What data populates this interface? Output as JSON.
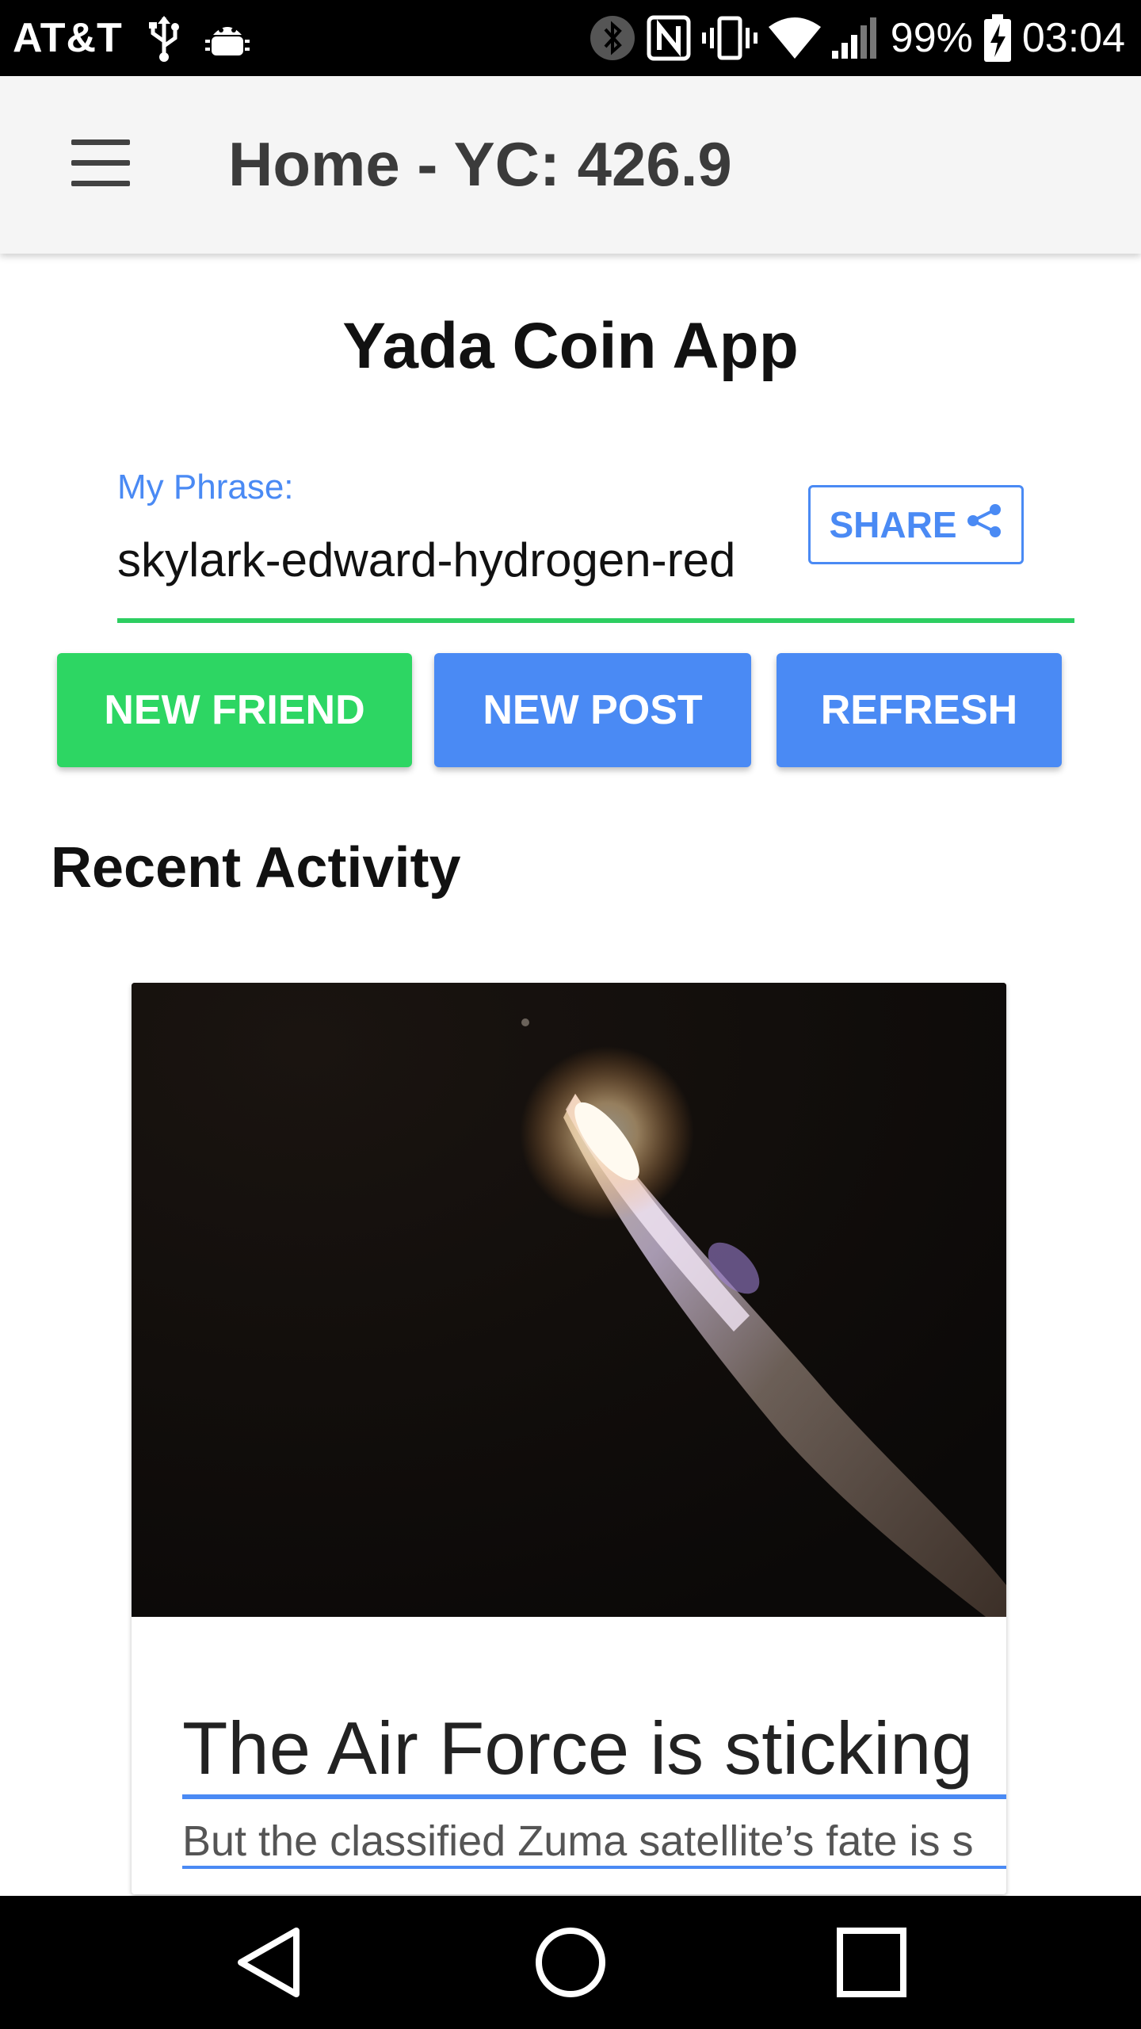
{
  "status_bar": {
    "carrier": "AT&T",
    "battery": "99%",
    "time": "03:04",
    "icons": [
      "usb-icon",
      "android-debug-icon",
      "bluetooth-icon",
      "nfc-icon",
      "vibrate-icon",
      "wifi-icon",
      "signal-icon",
      "battery-charging-icon"
    ]
  },
  "app_bar": {
    "title": "Home - YC: 426.9"
  },
  "main": {
    "app_title": "Yada Coin App",
    "phrase": {
      "label": "My Phrase:",
      "value": "skylark-edward-hydrogen-red",
      "share_label": "SHARE"
    },
    "buttons": {
      "new_friend": "NEW FRIEND",
      "new_post": "NEW POST",
      "refresh": "REFRESH"
    },
    "section_title": "Recent Activity",
    "card": {
      "headline": "The Air Force is sticking",
      "subtitle": "But the classified Zuma satellite’s fate is s"
    }
  },
  "colors": {
    "accent_blue": "#4a8af4",
    "accent_green": "#2dd663",
    "appbar_bg": "#f5f5f5"
  }
}
